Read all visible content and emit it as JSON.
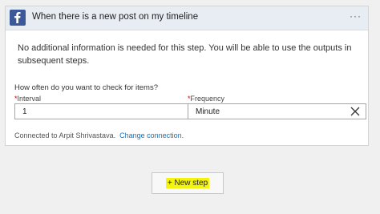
{
  "card": {
    "title": "When there is a new post on my timeline",
    "menu_icon": "more-dots-icon",
    "app_icon": "facebook-icon",
    "brand_color": "#3b5998"
  },
  "info": {
    "text": "No additional information is needed for this step. You will be able to use the outputs in subsequent steps."
  },
  "schedule": {
    "question": "How often do you want to check for items?",
    "interval_label": "Interval",
    "interval_value": "1",
    "frequency_label": "Frequency",
    "frequency_value": "Minute",
    "required_marker": "*"
  },
  "connection": {
    "text": "Connected to Arpit Shrivastava.",
    "change_link": "Change connection."
  },
  "new_step": {
    "label": "+ New step",
    "highlight_color": "#f4f40e"
  }
}
